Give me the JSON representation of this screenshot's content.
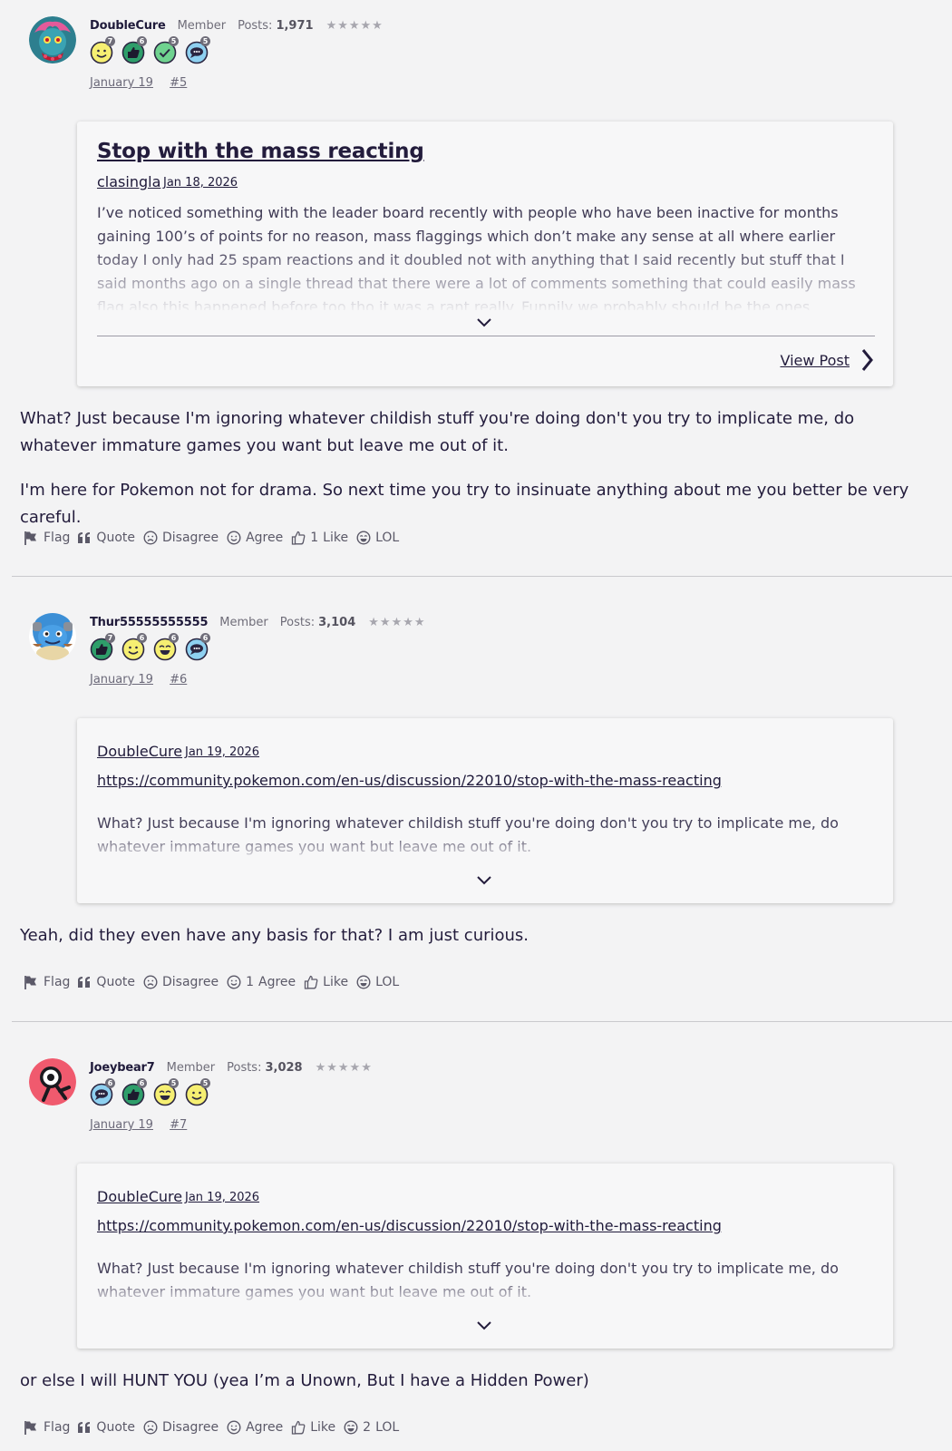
{
  "posts": [
    {
      "username": "DoubleCure",
      "role": "Member",
      "posts_label": "Posts:",
      "posts_count": "1,971",
      "stars": "★★★★★",
      "badges": [
        {
          "icon": "smile-badge-icon",
          "color": "#f6ef72",
          "level": "7"
        },
        {
          "icon": "thumbs-up-badge-icon",
          "color": "#2e9e6a",
          "level": "6"
        },
        {
          "icon": "check-badge-icon",
          "color": "#6fd28f",
          "level": "5"
        },
        {
          "icon": "chat-badge-icon",
          "color": "#8ed0f0",
          "level": "5"
        }
      ],
      "date": "January 19",
      "number": "#5",
      "quote": {
        "title": "Stop with the mass reacting",
        "author": "clasingla",
        "date": "Jan 18, 2026",
        "body": "I’ve noticed something with the leader board recently with people who have been inactive for months gaining 100’s of points for no reason, mass flaggings which don’t make any sense at all where earlier today I only had 25 spam reactions and it doubled not with anything that I said recently but stuff that I said months ago on a single thread that there were a lot of comments something that could easily mass flag also this happened before too tho it was a rant really. Funnily we probably should be the ones targeted... @DoubleCure",
        "view_label": "View Post"
      },
      "paragraphs": [
        "What? Just because I'm ignoring whatever childish stuff you're doing don't you try to implicate me, do whatever immature games you want but leave me out of it.",
        "I'm here for Pokemon not for drama. So next time you try to insinuate anything about me you better be very careful."
      ],
      "actions": {
        "flag": "Flag",
        "quote": "Quote",
        "disagree": "Disagree",
        "agree": "Agree",
        "like_count": "1",
        "like": "Like",
        "lol": "LOL"
      }
    },
    {
      "username": "Thur55555555555",
      "role": "Member",
      "posts_label": "Posts:",
      "posts_count": "3,104",
      "stars": "★★★★★",
      "badges": [
        {
          "icon": "thumbs-up-badge-icon",
          "color": "#2e9e6a",
          "level": "7"
        },
        {
          "icon": "smile-badge-icon",
          "color": "#f6ef72",
          "level": "6"
        },
        {
          "icon": "laugh-badge-icon",
          "color": "#f6ef72",
          "level": "6"
        },
        {
          "icon": "chat-badge-icon",
          "color": "#8ed0f0",
          "level": "6"
        }
      ],
      "date": "January 19",
      "number": "#6",
      "quote": {
        "author": "DoubleCure",
        "date": "Jan 19, 2026",
        "link": "https://community.pokemon.com/en-us/discussion/22010/stop-with-the-mass-reacting",
        "body": "What? Just because I'm ignoring whatever childish stuff you're doing don't you try to implicate me, do whatever immature games you want but leave me out of it."
      },
      "paragraphs": [
        "Yeah, did they even have any basis for that? I am just curious."
      ],
      "actions": {
        "flag": "Flag",
        "quote": "Quote",
        "disagree": "Disagree",
        "agree_count": "1",
        "agree": "Agree",
        "like": "Like",
        "lol": "LOL"
      }
    },
    {
      "username": "Joeybear7",
      "role": "Member",
      "posts_label": "Posts:",
      "posts_count": "3,028",
      "stars": "★★★★★",
      "badges": [
        {
          "icon": "chat-badge-icon",
          "color": "#8ed0f0",
          "level": "6"
        },
        {
          "icon": "thumbs-up-badge-icon",
          "color": "#2e9e6a",
          "level": "6"
        },
        {
          "icon": "laugh-badge-icon",
          "color": "#f6ef72",
          "level": "5"
        },
        {
          "icon": "smile-badge-icon",
          "color": "#f6ef72",
          "level": "5"
        }
      ],
      "date": "January 19",
      "number": "#7",
      "quote": {
        "author": "DoubleCure",
        "date": "Jan 19, 2026",
        "link": "https://community.pokemon.com/en-us/discussion/22010/stop-with-the-mass-reacting",
        "body": "What? Just because I'm ignoring whatever childish stuff you're doing don't you try to implicate me, do whatever immature games you want but leave me out of it."
      },
      "paragraphs": [
        "or else I will HUNT YOU (yea I’m a Unown, But I have a Hidden Power)"
      ],
      "actions": {
        "flag": "Flag",
        "quote": "Quote",
        "disagree": "Disagree",
        "agree": "Agree",
        "like": "Like",
        "lol_count": "2",
        "lol": "LOL"
      }
    }
  ]
}
